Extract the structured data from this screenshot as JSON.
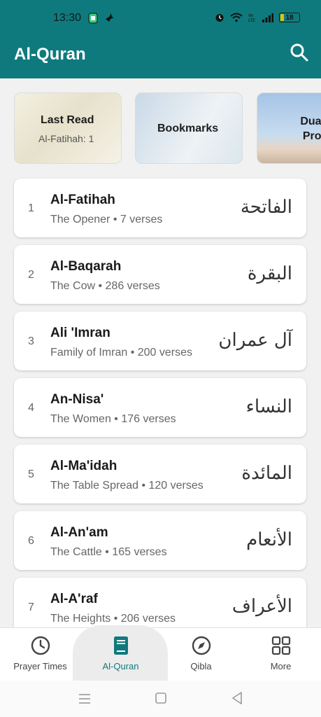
{
  "status_bar": {
    "time": "13:30",
    "battery": "18",
    "network": "Vo LTE"
  },
  "app_bar": {
    "title": "Al-Quran"
  },
  "quick_cards": [
    {
      "title": "Last Read",
      "subtitle": "Al-Fatihah: 1"
    },
    {
      "title": "Bookmarks"
    },
    {
      "title": "Duas of Prophe"
    }
  ],
  "surahs": [
    {
      "number": "1",
      "name": "Al-Fatihah",
      "meta": "The Opener • 7 verses",
      "arabic": "الفاتحة"
    },
    {
      "number": "2",
      "name": "Al-Baqarah",
      "meta": "The Cow • 286 verses",
      "arabic": "البقرة"
    },
    {
      "number": "3",
      "name": "Ali 'Imran",
      "meta": "Family of Imran • 200 verses",
      "arabic": "آل عمران"
    },
    {
      "number": "4",
      "name": "An-Nisa'",
      "meta": "The Women • 176 verses",
      "arabic": "النساء"
    },
    {
      "number": "5",
      "name": "Al-Ma'idah",
      "meta": "The Table Spread • 120 verses",
      "arabic": "المائدة"
    },
    {
      "number": "6",
      "name": "Al-An'am",
      "meta": "The Cattle • 165 verses",
      "arabic": "الأنعام"
    },
    {
      "number": "7",
      "name": "Al-A'raf",
      "meta": "The Heights • 206 verses",
      "arabic": "الأعراف"
    }
  ],
  "bottom_nav": [
    {
      "label": "Prayer Times",
      "icon": "clock-icon"
    },
    {
      "label": "Al-Quran",
      "icon": "book-icon"
    },
    {
      "label": "Qibla",
      "icon": "compass-icon"
    },
    {
      "label": "More",
      "icon": "grid-icon"
    }
  ],
  "colors": {
    "primary": "#0f7a7d",
    "battery": "#e2c200"
  }
}
